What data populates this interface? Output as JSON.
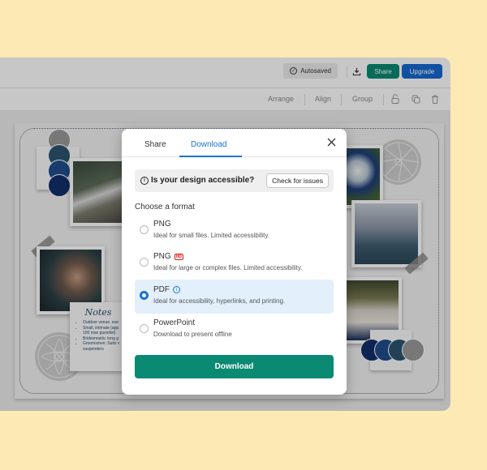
{
  "topbar": {
    "autosaved_label": "Autosaved",
    "download_icon": "download-icon",
    "share_label": "Share",
    "upgrade_label": "Upgrade",
    "share_color": "#0b8a73",
    "upgrade_color": "#1668cf"
  },
  "toolbar": {
    "arrange_label": "Arrange",
    "align_label": "Align",
    "group_label": "Group",
    "icons": [
      "unlock-icon",
      "duplicate-icon",
      "trash-icon"
    ]
  },
  "canvas": {
    "notes": {
      "title": "Notes",
      "items": [
        "Outdoor venue, eve",
        "Small, intimate (app 100 max guestlist)",
        "Bridesmaids: long g",
        "Groomsmen: Suits v suspenders"
      ]
    },
    "palette": [
      "#9a9a9a",
      "#2c5470",
      "#1f4e8c",
      "#12306b"
    ]
  },
  "modal": {
    "tabs": [
      {
        "label": "Share",
        "active": false
      },
      {
        "label": "Download",
        "active": true
      }
    ],
    "accessibility": {
      "question": "Is your design accessible?",
      "button_label": "Check for issues"
    },
    "choose_format_label": "Choose a format",
    "formats": [
      {
        "title": "PNG",
        "description": "Ideal for small files. Limited accessibility.",
        "badge": null,
        "selected": false
      },
      {
        "title": "PNG",
        "description": "Ideal for large or complex files. Limited accessibility.",
        "badge": "HD",
        "selected": false
      },
      {
        "title": "PDF",
        "description": "Ideal for accessibility, hyperlinks, and printing.",
        "badge": null,
        "info": true,
        "selected": true
      },
      {
        "title": "PowerPoint",
        "description": "Download to present offline",
        "badge": null,
        "selected": false
      }
    ],
    "download_button_label": "Download",
    "accent_color": "#1a73d1"
  }
}
